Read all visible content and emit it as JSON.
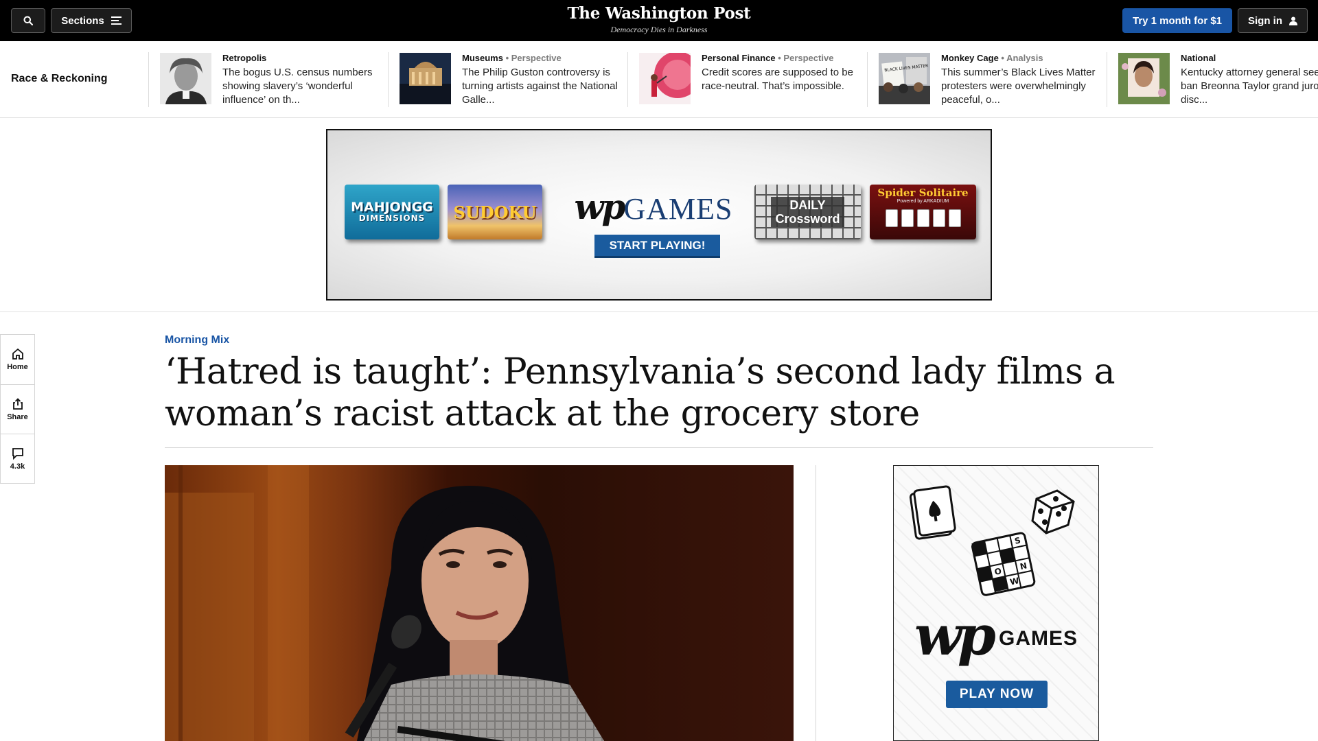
{
  "header": {
    "sections_label": "Sections",
    "logo_text": "The Washington Post",
    "tagline": "Democracy Dies in Darkness",
    "subscribe_label": "Try 1 month for $1",
    "signin_label": "Sign in",
    "icons": {
      "search": "search-icon",
      "menu": "menu-icon",
      "user": "user-icon"
    }
  },
  "strip": {
    "label": "Race & Reckoning",
    "stories": [
      {
        "section": "Retropolis",
        "tag": "",
        "headline": "The bogus U.S. census numbers showing slavery’s ‘wonderful influence’ on th..."
      },
      {
        "section": "Museums",
        "tag": " • Perspective",
        "headline": "The Philip Guston controversy is turning artists against the National Galle..."
      },
      {
        "section": "Personal Finance",
        "tag": " • Perspective",
        "headline": "Credit scores are supposed to be race-neutral. That’s impossible."
      },
      {
        "section": "Monkey Cage",
        "tag": " • Analysis",
        "headline": "This summer’s Black Lives Matter protesters were overwhelmingly peaceful, o..."
      },
      {
        "section": "National",
        "tag": "",
        "headline": "Kentucky attorney general seeks to ban Breonna Taylor grand juror from disc..."
      }
    ],
    "thumb_texts": {
      "protest_sign": "BLACK LIVES MATTER"
    }
  },
  "ad_banner": {
    "tiles": {
      "mahjongg_line1": "MAHJONGG",
      "mahjongg_line2": "DIMENSIONS",
      "sudoku": "SUDOKU",
      "crossword_line1": "DAILY",
      "crossword_line2": "Crossword",
      "spider": "Spider Solitaire",
      "spider_powered": "Powered by ARKADIUM"
    },
    "brand_wp": "wp",
    "brand_games": "GAMES",
    "cta": "START PLAYING!"
  },
  "rail": {
    "home_label": "Home",
    "share_label": "Share",
    "comments_label": "4.3k"
  },
  "article": {
    "kicker": "Morning Mix",
    "title": "‘Hatred is taught’: Pennsylvania’s second lady films a woman’s racist attack at the grocery store"
  },
  "side_ad": {
    "crossword_letters": [
      "S",
      "O",
      "N",
      "W"
    ],
    "brand_wp": "wp",
    "brand_games": "GAMES",
    "cta": "PLAY NOW"
  },
  "colors": {
    "masthead_bg": "#000000",
    "accent_blue": "#1955a5",
    "kicker_blue": "#1955a5"
  }
}
